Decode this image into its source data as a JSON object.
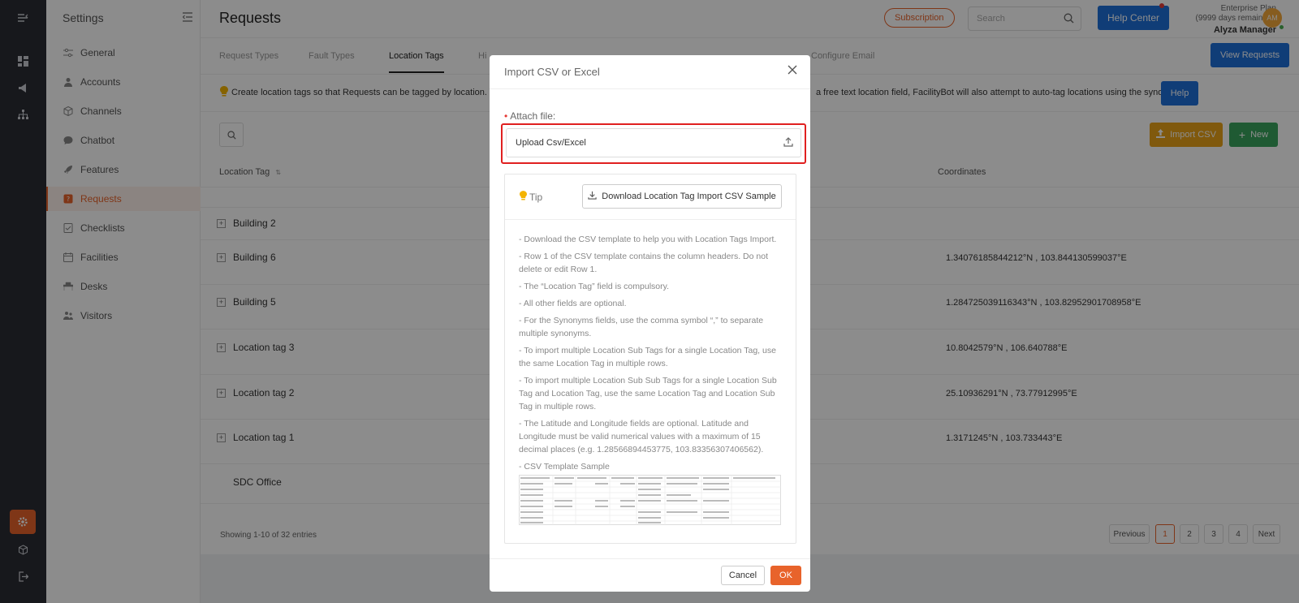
{
  "sidebar": {
    "title": "Settings",
    "items": [
      {
        "label": "General",
        "icon": "sliders-icon"
      },
      {
        "label": "Accounts",
        "icon": "user-icon"
      },
      {
        "label": "Channels",
        "icon": "cube-icon"
      },
      {
        "label": "Chatbot",
        "icon": "chat-icon"
      },
      {
        "label": "Features",
        "icon": "rocket-icon"
      },
      {
        "label": "Requests",
        "icon": "question-icon"
      },
      {
        "label": "Checklists",
        "icon": "checklist-icon"
      },
      {
        "label": "Facilities",
        "icon": "calendar-icon"
      },
      {
        "label": "Desks",
        "icon": "desk-icon"
      },
      {
        "label": "Visitors",
        "icon": "visitors-icon"
      }
    ]
  },
  "header": {
    "title": "Requests",
    "subscription": "Subscription",
    "search_placeholder": "Search",
    "help_center": "Help Center",
    "plan": "Enterprise Plan",
    "plan_days": "(9999 days remaining)",
    "user_name": "Alyza Manager",
    "avatar_initials": "AM"
  },
  "tabs": {
    "items": [
      "Request Types",
      "Fault Types",
      "Location Tags",
      "Hi",
      "Configure Email"
    ],
    "active": "Location Tags",
    "view_requests": "View Requests"
  },
  "info": {
    "left": "Create location tags so that Requests can be tagged by location. Th",
    "right": "a free text location field, FacilityBot will also attempt to auto-tag locations using the synonyms.",
    "help": "Help"
  },
  "table": {
    "import_csv": "Import CSV",
    "new": "New",
    "col_location": "Location Tag",
    "col_coordinates": "Coordinates",
    "rows": [
      {
        "name": "Building 2",
        "coord": ""
      },
      {
        "name": "Building 6",
        "coord": "1.34076185844212°N , 103.844130599037°E"
      },
      {
        "name": "Building 5",
        "coord": "1.284725039116343°N , 103.82952901708958°E"
      },
      {
        "name": "Location tag 3",
        "coord": "10.8042579°N , 106.640788°E"
      },
      {
        "name": "Location tag 2",
        "coord": "25.10936291°N , 73.77912995°E"
      },
      {
        "name": "Location tag 1",
        "coord": "1.3171245°N , 103.733443°E"
      },
      {
        "name": "SDC Office",
        "coord": ""
      }
    ],
    "showing": "Showing 1-10 of 32 entries",
    "pagination": {
      "previous": "Previous",
      "pages": [
        "1",
        "2",
        "3",
        "4"
      ],
      "next": "Next",
      "current": "1"
    }
  },
  "modal": {
    "title": "Import CSV or Excel",
    "attach_label": "Attach file:",
    "upload_label": "Upload Csv/Excel",
    "tip_label": "Tip",
    "download_sample": "Download Location Tag Import CSV Sample",
    "tips": [
      "- Download the CSV template to help you with Location Tags Import.",
      "- Row 1 of the CSV template contains the column headers. Do not delete or edit Row 1.",
      "- The “Location Tag” field is compulsory.",
      "- All other fields are optional.",
      "- For the Synonyms fields, use the comma symbol “,” to separate multiple synonyms.",
      "- To import multiple Location Sub Tags for a single Location Tag, use the same Location Tag in multiple rows.",
      "- To import multiple Location Sub Sub Tags for a single Location Sub Tag and Location Tag, use the same Location Tag and Location Sub Tag in multiple rows.",
      "- The Latitude and Longitude fields are optional. Latitude and Longitude must be valid numerical values with a maximum of 15 decimal places (e.g. 1.28566894453775, 103.83356307406562).",
      "- CSV Template Sample"
    ],
    "cancel": "Cancel",
    "ok": "OK"
  },
  "colors": {
    "accent": "#e8632b",
    "primary": "#1e6fd9",
    "import_csv": "#e9a318",
    "new": "#3aa55d",
    "highlight": "#e02020"
  }
}
